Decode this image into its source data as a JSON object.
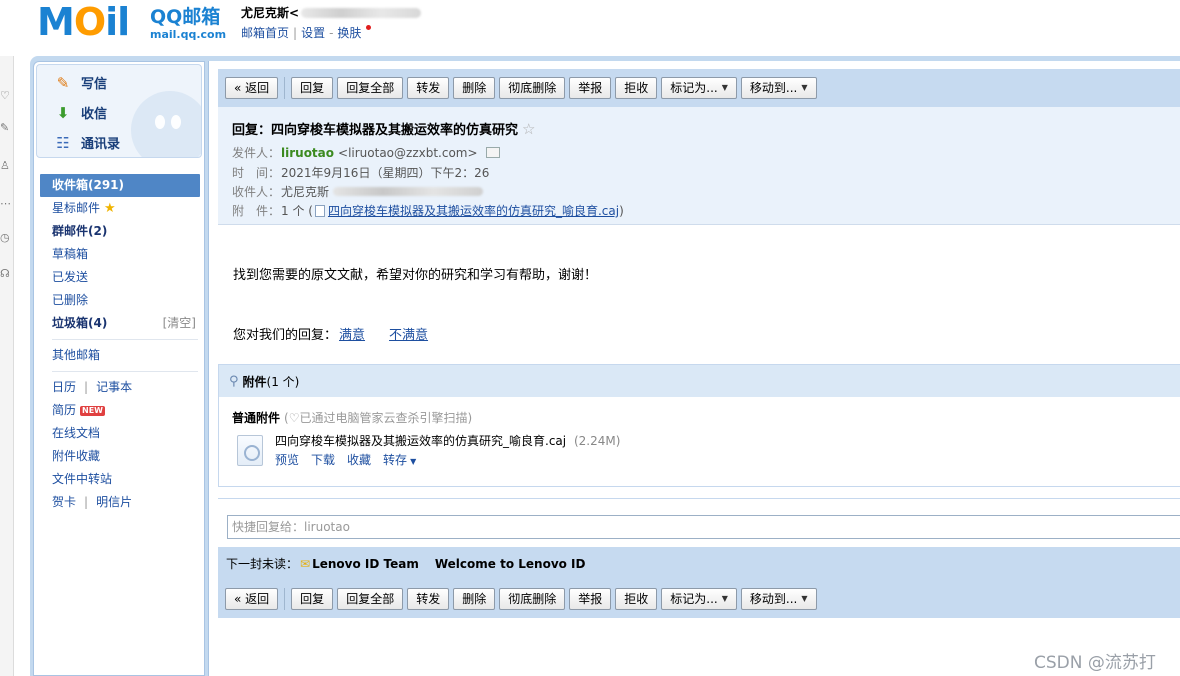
{
  "header": {
    "logo_moil": "MOil",
    "brand": "QQ邮箱",
    "domain": "mail.qq.com",
    "user_name": "尤尼克斯<",
    "links": {
      "home": "邮箱首页",
      "sep": "|",
      "settings": "设置",
      "dash": "-",
      "skin": "换肤"
    }
  },
  "sidebar": {
    "actions": {
      "write": "写信",
      "receive": "收信",
      "contacts": "通讯录"
    },
    "folders": {
      "inbox": "收件箱(291)",
      "starred": "星标邮件",
      "group": "群邮件(2)",
      "drafts": "草稿箱",
      "sent": "已发送",
      "deleted": "已删除",
      "spam": "垃圾箱(4)",
      "spam_clear": "[清空]",
      "other": "其他邮箱"
    },
    "apps": {
      "calendar": "日历",
      "notes": "记事本",
      "resume": "简历",
      "resume_badge": "NEW",
      "docs": "在线文档",
      "attachments": "附件收藏",
      "transfer": "文件中转站",
      "card": "贺卡",
      "postcard": "明信片",
      "pipe": "|"
    }
  },
  "toolbar": {
    "back": "« 返回",
    "reply": "回复",
    "reply_all": "回复全部",
    "forward": "转发",
    "delete": "删除",
    "delete_forever": "彻底删除",
    "report": "举报",
    "reject": "拒收",
    "mark_as": "标记为...",
    "move_to": "移动到..."
  },
  "mail": {
    "subject": "回复：四向穿梭车模拟器及其搬运效率的仿真研究",
    "star": "☆",
    "from_label": "发件人：",
    "from_name": "liruotao",
    "from_addr": "<liruotao@zzxbt.com>",
    "time_label": "时　间：",
    "time_value": "2021年9月16日（星期四）下午2：26",
    "to_label": "收件人：",
    "to_value": "尤尼克斯",
    "att_label": "附　件：",
    "att_count": "1 个 (",
    "att_link": "四向穿梭车模拟器及其搬运效率的仿真研究_喻良育.caj",
    "att_close": ")",
    "body": "找到您需要的原文文献，希望对你的研究和学习有帮助，谢谢！",
    "feedback_label": "您对我们的回复：",
    "feedback_yes": "满意",
    "feedback_no": "不满意"
  },
  "attachments": {
    "title": "附件",
    "count": "(1 个)",
    "normal_label": "普通附件",
    "scan_note": "(♡已通过电脑管家云查杀引擎扫描)",
    "file_name": "四向穿梭车模拟器及其搬运效率的仿真研究_喻良育.caj",
    "file_size": "(2.24M)",
    "actions": {
      "preview": "预览",
      "download": "下载",
      "collect": "收藏",
      "save_to": "转存"
    }
  },
  "quick_reply": {
    "placeholder": "快捷回复给：liruotao"
  },
  "next_unread": {
    "label": "下一封未读：",
    "sender": "Lenovo ID Team",
    "subject": "Welcome to Lenovo ID"
  },
  "watermark": "CSDN @流苏打",
  "colors": {
    "accent_blue": "#1b82d2",
    "toolbar_bg": "#c6daf0",
    "sender_green": "#3b8a1f",
    "active_nav": "#4f86c6"
  }
}
